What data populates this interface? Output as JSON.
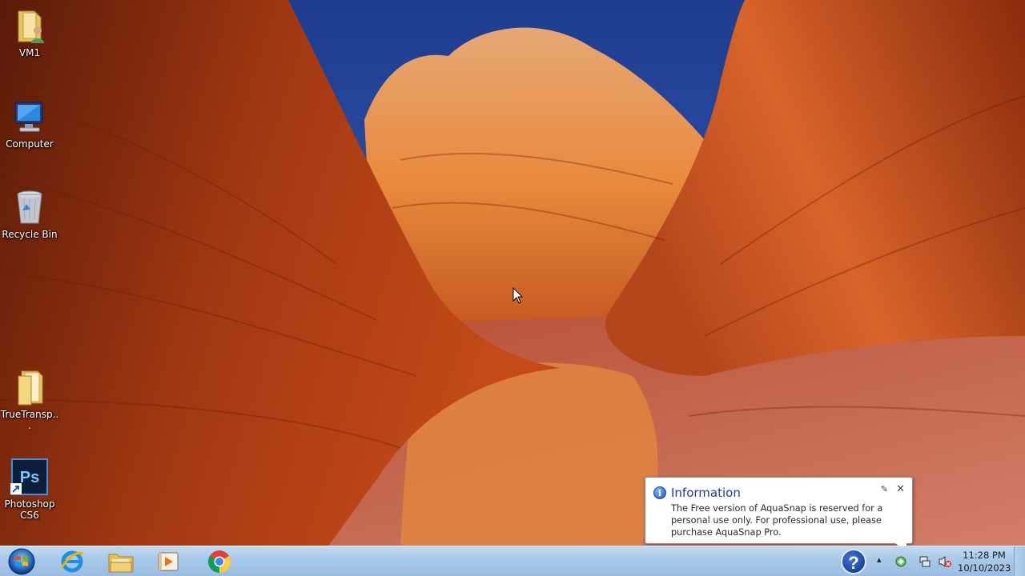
{
  "desktop": {
    "icons": [
      {
        "label": "VM1",
        "icon": "user-folder-icon"
      },
      {
        "label": "Computer",
        "icon": "computer-icon"
      },
      {
        "label": "Recycle Bin",
        "icon": "recycle-bin-icon"
      },
      {
        "label": "TrueTransp...",
        "icon": "folder-icon"
      },
      {
        "label": "Photoshop CS6",
        "icon": "photoshop-icon"
      }
    ]
  },
  "notification": {
    "title": "Information",
    "message": "The Free version of AquaSnap is reserved for a personal use only. For professional use, please purchase AquaSnap Pro.",
    "icon": "info-icon",
    "pin_glyph": "✎",
    "close_glyph": "✕"
  },
  "taskbar": {
    "pinned": [
      {
        "name": "internet-explorer",
        "icon": "internet-explorer-icon"
      },
      {
        "name": "windows-explorer",
        "icon": "file-explorer-icon"
      },
      {
        "name": "media-player",
        "icon": "media-player-icon"
      },
      {
        "name": "chrome",
        "icon": "chrome-icon"
      }
    ],
    "tray": {
      "help_glyph": "?",
      "show_hidden_glyph": "▴",
      "clock_time": "11:28 PM",
      "clock_date": "10/10/2023"
    }
  }
}
